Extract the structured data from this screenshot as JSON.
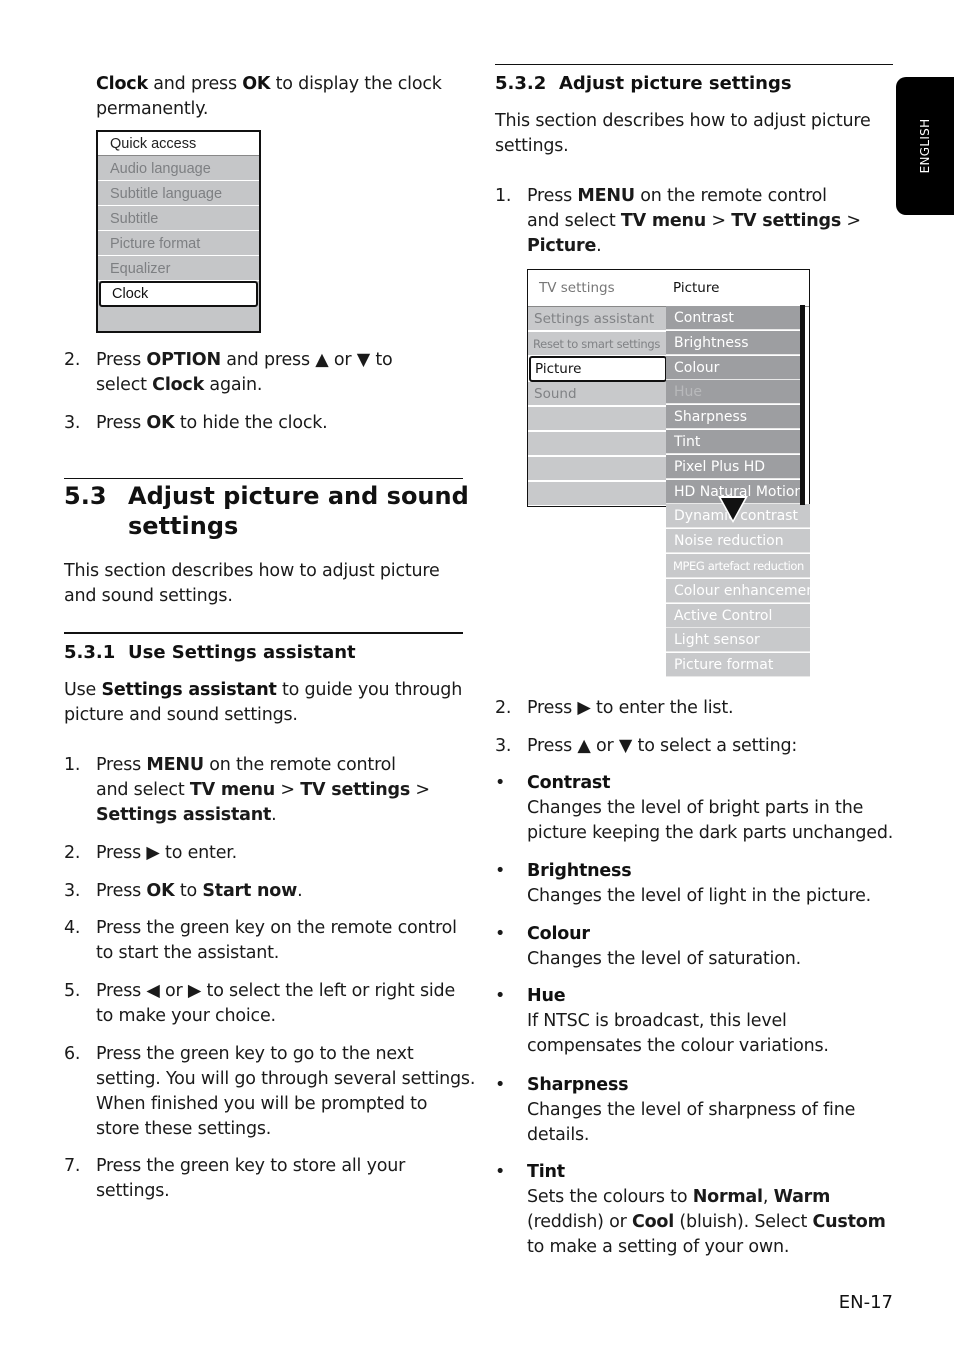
{
  "side_tab": {
    "label": "ENGLISH"
  },
  "left_column": {
    "intro_lines": [
      "<b>Clock</b> and press <b>OK</b> to display the clock",
      "permanently."
    ],
    "quick_access_menu": {
      "title": "Quick access",
      "items": [
        {
          "label": "Audio language",
          "state": "disabled"
        },
        {
          "label": "Subtitle language",
          "state": "disabled"
        },
        {
          "label": "Subtitle",
          "state": "disabled"
        },
        {
          "label": "Picture format",
          "state": "disabled"
        },
        {
          "label": "Equalizer",
          "state": "disabled"
        },
        {
          "label": "Clock",
          "state": "selected"
        }
      ]
    },
    "steps_a": [
      {
        "num": "2.",
        "lines": [
          "Press <b>OPTION</b> and press ▲ or ▼ to",
          "select <b>Clock</b> again."
        ]
      },
      {
        "num": "3.",
        "lines": [
          "Press <b>OK</b> to hide the clock."
        ]
      }
    ],
    "section_5_3": {
      "number": "5.3",
      "title_lines": [
        "Adjust picture and sound",
        "settings"
      ],
      "intro_lines": [
        "This section describes how to adjust picture",
        "and sound settings."
      ]
    },
    "section_5_3_1": {
      "number": "5.3.1",
      "title": "Use Settings assistant",
      "intro_lines": [
        "Use <b>Settings assistant</b> to guide you through",
        "picture and sound settings."
      ],
      "steps": [
        {
          "num": "1.",
          "lines": [
            "Press <b>MENU</b> on the remote control",
            "and select <b>TV menu</b> &gt; <b>TV settings</b> &gt;",
            "<b>Settings assistant</b>."
          ]
        },
        {
          "num": "2.",
          "lines": [
            "Press ▶ to enter."
          ]
        },
        {
          "num": "3.",
          "lines": [
            "Press <b>OK</b> to <b>Start now</b>."
          ]
        },
        {
          "num": "4.",
          "lines": [
            "Press the green key on the remote control",
            "to start the assistant."
          ]
        },
        {
          "num": "5.",
          "lines": [
            "Press ◀ or ▶ to select the left or right side",
            "to make your choice."
          ]
        },
        {
          "num": "6.",
          "lines": [
            "Press the green key to go to the next",
            "setting. You will go through several settings.",
            "When finished you will be prompted to",
            "store these settings."
          ]
        },
        {
          "num": "7.",
          "lines": [
            "Press the green key to store all your",
            "settings."
          ]
        }
      ]
    }
  },
  "right_column": {
    "section_5_3_2": {
      "number": "5.3.2",
      "title": "Adjust picture settings",
      "intro_lines": [
        "This section describes how to adjust picture",
        "settings."
      ],
      "step1": {
        "num": "1.",
        "lines": [
          "Press <b>MENU</b> on the remote control",
          "and select <b>TV menu</b> &gt; <b>TV settings</b> &gt;",
          "<b>Picture</b>."
        ]
      }
    },
    "tv_menu": {
      "header_left": "TV settings",
      "header_right": "Picture",
      "left_items": [
        {
          "label": "Settings assistant",
          "state": "normal"
        },
        {
          "label": "Reset to smart settings",
          "state": "normal"
        },
        {
          "label": "Picture",
          "state": "selected"
        },
        {
          "label": "Sound",
          "state": "normal"
        },
        {
          "label": "",
          "state": "empty"
        },
        {
          "label": "",
          "state": "empty"
        },
        {
          "label": "",
          "state": "empty"
        },
        {
          "label": "",
          "state": "empty"
        }
      ],
      "right_items": [
        {
          "label": "Contrast",
          "state": "visible"
        },
        {
          "label": "Brightness",
          "state": "visible"
        },
        {
          "label": "Colour",
          "state": "visible"
        },
        {
          "label": "Hue",
          "state": "disabled"
        },
        {
          "label": "Sharpness",
          "state": "visible"
        },
        {
          "label": "Tint",
          "state": "visible"
        },
        {
          "label": "Pixel Plus HD",
          "state": "visible"
        },
        {
          "label": "HD Natural Motion",
          "state": "visible"
        },
        {
          "label": "Dynamic contrast",
          "state": "overflow"
        },
        {
          "label": "Noise reduction",
          "state": "overflow"
        },
        {
          "label": "MPEG artefact reduction",
          "state": "overflow"
        },
        {
          "label": "Colour enhancement",
          "state": "overflow"
        },
        {
          "label": "Active Control",
          "state": "overflow"
        },
        {
          "label": "Light sensor",
          "state": "overflow"
        },
        {
          "label": "Picture format",
          "state": "overflow"
        }
      ]
    },
    "steps_b": [
      {
        "num": "2.",
        "lines": [
          "Press ▶ to enter the list."
        ]
      },
      {
        "num": "3.",
        "lines": [
          "Press ▲ or ▼ to select a setting:"
        ]
      }
    ],
    "settings_descriptions": [
      {
        "name": "Contrast",
        "lines": [
          "Changes the level of bright parts in the",
          "picture keeping the dark parts unchanged."
        ]
      },
      {
        "name": "Brightness",
        "lines": [
          "Changes the level of light in the picture."
        ]
      },
      {
        "name": "Colour",
        "lines": [
          "Changes the level of saturation."
        ]
      },
      {
        "name": "Hue",
        "lines": [
          "If NTSC is broadcast, this level",
          "compensates the colour variations."
        ]
      },
      {
        "name": "Sharpness",
        "lines": [
          "Changes the level of sharpness of fine",
          "details."
        ]
      },
      {
        "name": "Tint",
        "lines": [
          "Sets the colours to <b>Normal</b>, <b>Warm</b>",
          "(reddish) or <b>Cool</b> (bluish). Select <b>Custom</b>",
          "to make a setting of your own."
        ]
      }
    ]
  },
  "footer": {
    "page_number": "EN-17"
  }
}
